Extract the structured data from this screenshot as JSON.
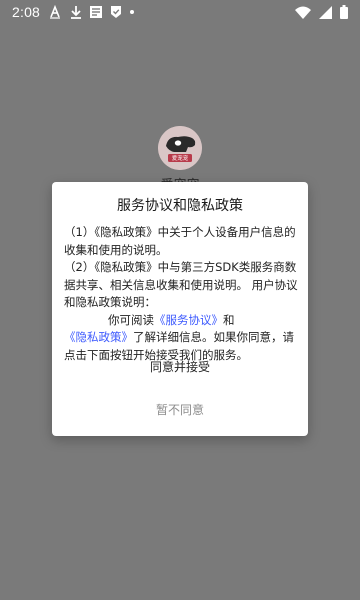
{
  "status_bar": {
    "time": "2:08",
    "left_icons": [
      "font-download-icon",
      "download-icon",
      "text-icon",
      "shield-check-icon",
      "dot-icon"
    ],
    "right_icons": [
      "wifi-icon",
      "cellular-signal-icon",
      "battery-icon"
    ]
  },
  "splash": {
    "app_name": "爱宠宠",
    "logo_text": "爱宠宠",
    "logo_bg": "#d8c8c8",
    "logo_accent": "#b83a4a"
  },
  "dialog": {
    "title": "服务协议和隐私政策",
    "paragraph1": "（1）《隐私政策》中关于个人设备用户信息的收集和使用的说明。",
    "paragraph2": "（2）《隐私政策》中与第三方SDK类服务商数据共享、相关信息收集和使用说明。 用户协议和隐私政策说明：",
    "paragraph3_pre": "你可阅读",
    "service_link": "《服务协议》",
    "paragraph3_and": "和",
    "privacy_link": "《隐私政策》",
    "paragraph3_post": "了解详细信息。如果你同意，请点击下面按钮开始接受我们的服务。",
    "accept_label": "同意并接受",
    "decline_label": "暂不同意"
  },
  "colors": {
    "overlay": "#7a7a7a",
    "link": "#3d5afe",
    "dialog_bg": "#ffffff",
    "decline_text": "#8c8c8c"
  }
}
